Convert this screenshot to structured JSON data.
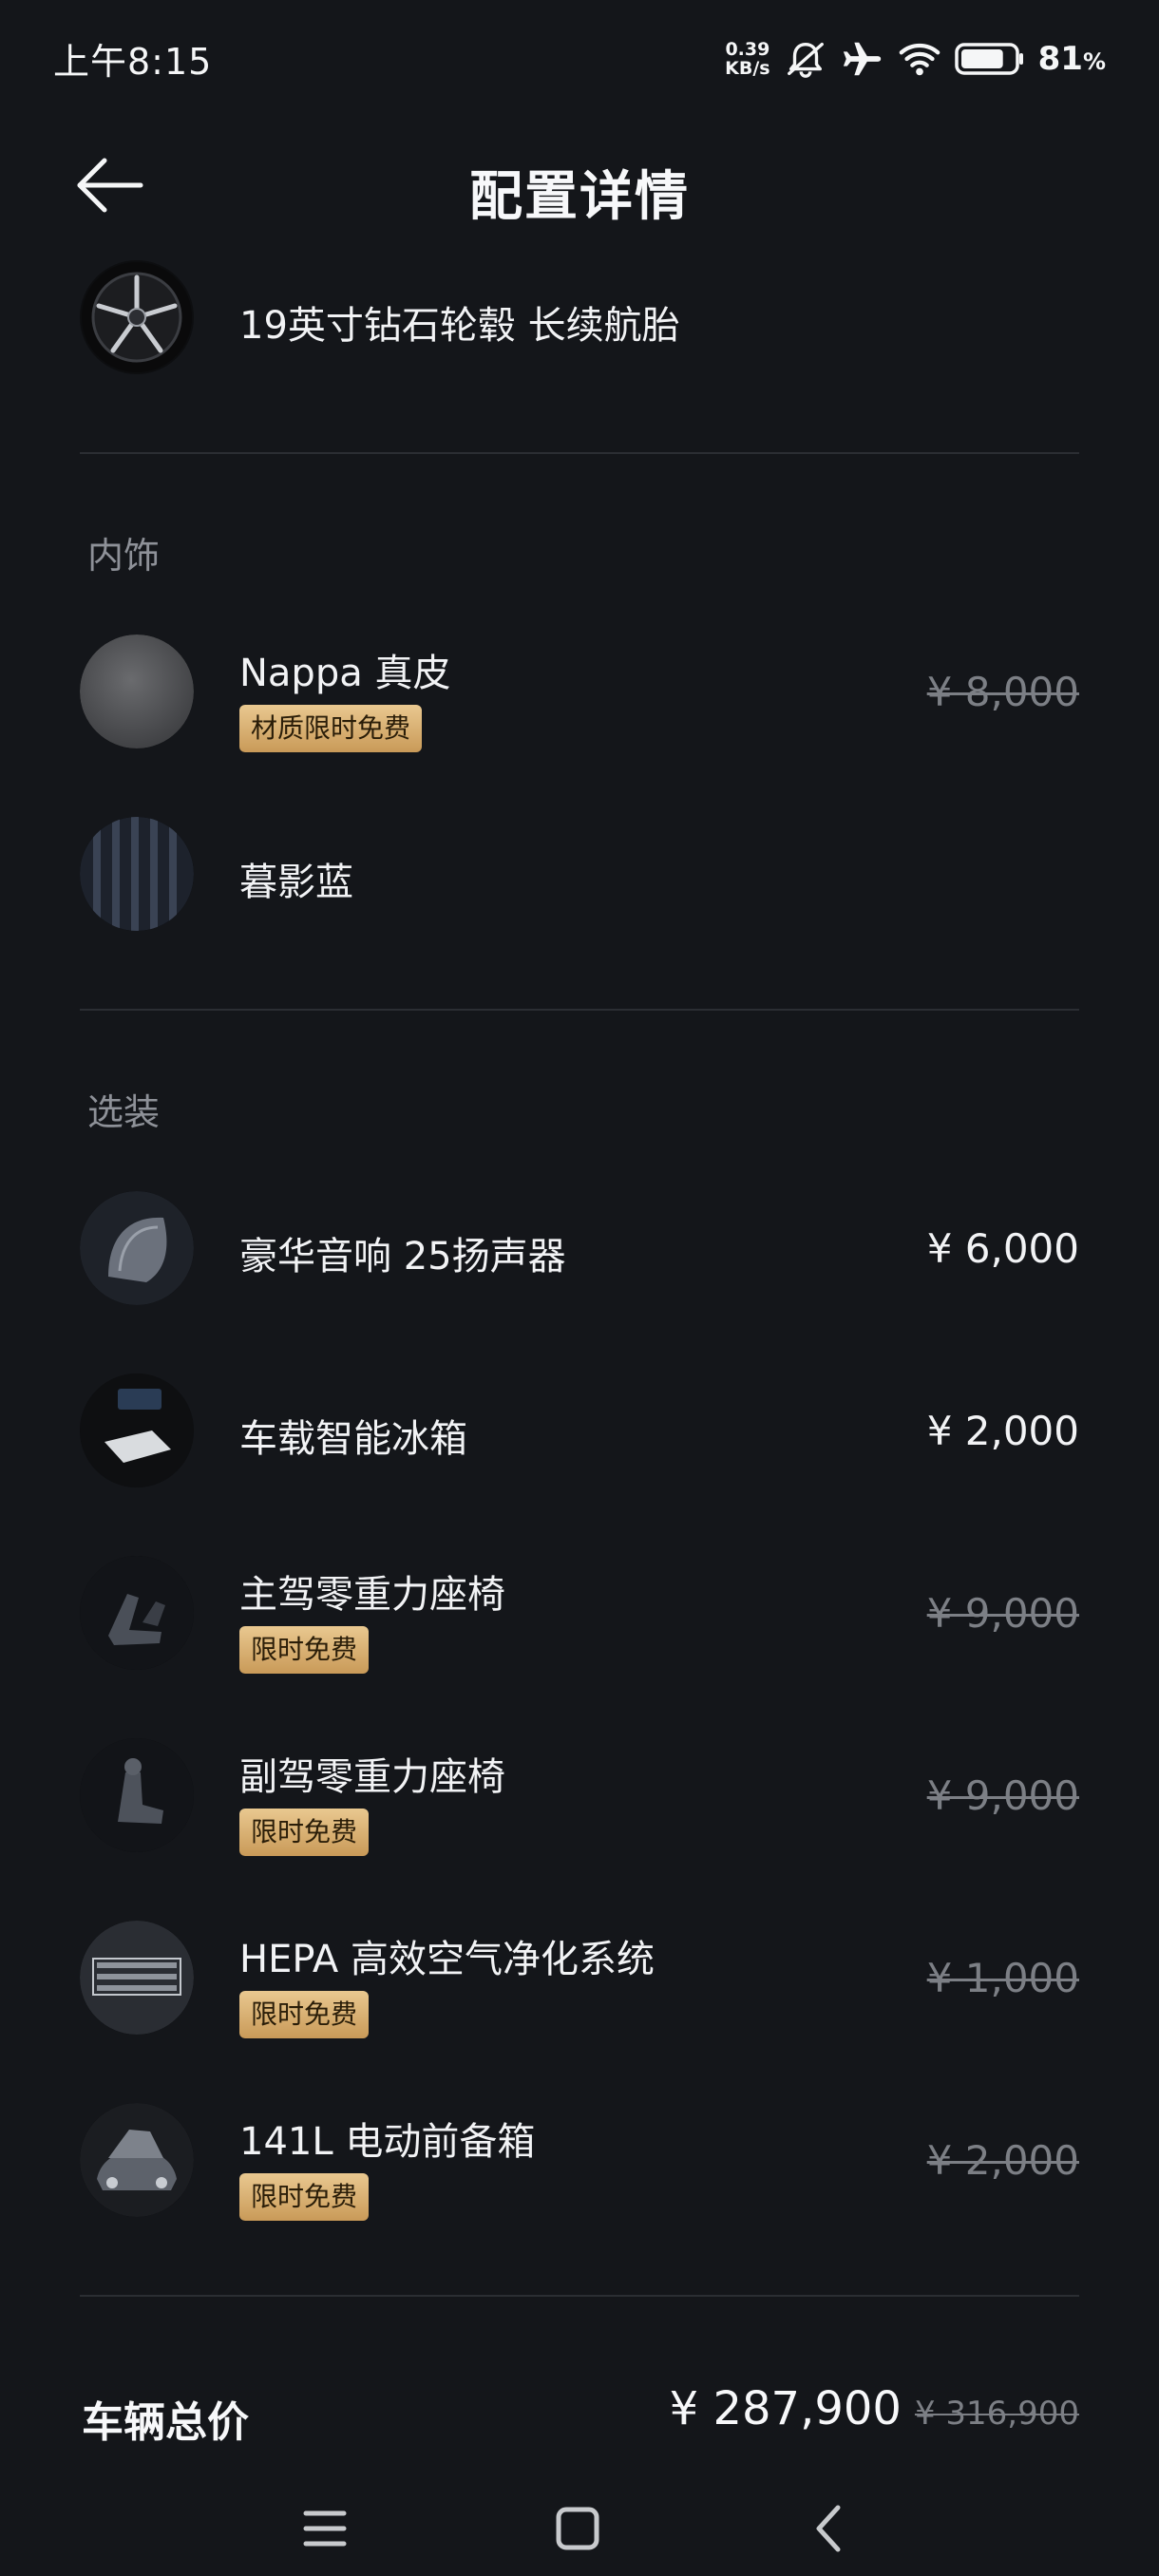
{
  "status_bar": {
    "time": "上午8:15",
    "net_speed_value": "0.39",
    "net_speed_unit": "KB/s",
    "battery_percent": "81",
    "battery_level": 0.81,
    "battery_suffix": "%",
    "icons": [
      "silent-bell-icon",
      "airplane-icon",
      "wifi-icon",
      "battery-icon"
    ]
  },
  "header": {
    "title": "配置详情",
    "back_icon": "back-arrow-icon"
  },
  "wheel": {
    "name": "19英寸钻石轮毂 长续航胎"
  },
  "interior": {
    "label": "内饰",
    "items": [
      {
        "name": "Nappa 真皮",
        "badge": "材质限时免费",
        "price": "¥ 8,000",
        "price_struck": true
      },
      {
        "name": "暮影蓝"
      }
    ]
  },
  "options": {
    "label": "选装",
    "items": [
      {
        "name": "豪华音响 25扬声器",
        "price": "¥ 6,000",
        "price_struck": false
      },
      {
        "name": "车载智能冰箱",
        "price": "¥ 2,000",
        "price_struck": false
      },
      {
        "name": "主驾零重力座椅",
        "badge": "限时免费",
        "price": "¥ 9,000",
        "price_struck": true
      },
      {
        "name": "副驾零重力座椅",
        "badge": "限时免费",
        "price": "¥ 9,000",
        "price_struck": true
      },
      {
        "name": "HEPA 高效空气净化系统",
        "badge": "限时免费",
        "price": "¥ 1,000",
        "price_struck": true
      },
      {
        "name": "141L 电动前备箱",
        "badge": "限时免费",
        "price": "¥ 2,000",
        "price_struck": true
      }
    ]
  },
  "total": {
    "label": "车辆总价",
    "price": "¥ 287,900",
    "original_price": "¥ 316,900"
  },
  "nav_bar": {
    "icons": [
      "menu-icon",
      "home-icon",
      "back-icon"
    ]
  },
  "colors": {
    "background": "#14161a",
    "badge_gold": "#d6ae6e",
    "divider": "#2b2e33",
    "muted_text": "#8e9198"
  }
}
